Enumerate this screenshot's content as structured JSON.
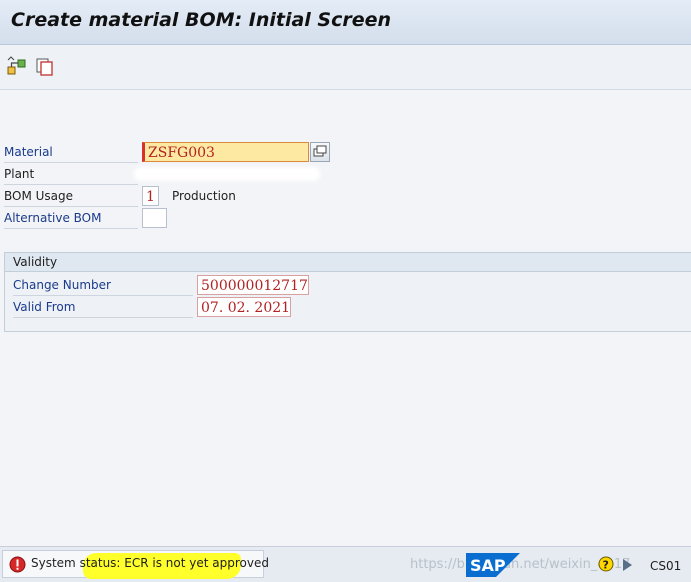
{
  "window": {
    "title": "Create material BOM: Initial Screen"
  },
  "toolbar": {
    "icons": [
      "hierarchy-icon",
      "copy-icon"
    ]
  },
  "form": {
    "material": {
      "label": "Material",
      "value": "ZSFG003"
    },
    "plant": {
      "label": "Plant"
    },
    "bom_usage": {
      "label": "BOM Usage",
      "value": "1",
      "description": "Production"
    },
    "alternative_bom": {
      "label": "Alternative BOM",
      "value": ""
    }
  },
  "validity": {
    "title": "Validity",
    "change_number": {
      "label": "Change Number",
      "value": "500000012717"
    },
    "valid_from": {
      "label": "Valid From",
      "value": "07. 02. 2021"
    }
  },
  "status_bar": {
    "message": "System status: ECR is not yet approved",
    "message_type": "error",
    "watermark": "https://blog.csdn.net/weixin_4217",
    "logo": "SAP",
    "transaction": "CS01"
  },
  "colors": {
    "label_blue": "#1a3a8a",
    "field_value": "#b22222",
    "active_field": "#fde9a2",
    "highlight": "#ffff20",
    "sap_blue": "#0a6ed1"
  }
}
